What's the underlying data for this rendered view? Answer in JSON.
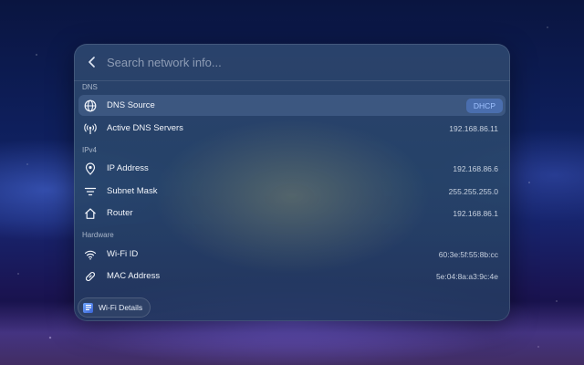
{
  "search": {
    "placeholder": "Search network info..."
  },
  "sections": {
    "dns": "DNS",
    "ipv4": "IPv4",
    "hardware": "Hardware"
  },
  "rows": {
    "dns_source": {
      "label": "DNS Source",
      "badge": "DHCP",
      "icon": "globe-icon"
    },
    "active_dns": {
      "label": "Active DNS Servers",
      "value": "192.168.86.11",
      "icon": "broadcast-icon"
    },
    "ip_address": {
      "label": "IP Address",
      "value": "192.168.86.6",
      "icon": "location-pin-icon"
    },
    "subnet_mask": {
      "label": "Subnet Mask",
      "value": "255.255.255.0",
      "icon": "filter-lines-icon"
    },
    "router": {
      "label": "Router",
      "value": "192.168.86.1",
      "icon": "home-icon"
    },
    "wifi_id": {
      "label": "Wi-Fi ID",
      "value": "60:3e:5f:55:8b:cc",
      "icon": "wifi-icon"
    },
    "mac_address": {
      "label": "MAC Address",
      "value": "5e:04:8a:a3:9c:4e",
      "icon": "link-icon"
    }
  },
  "footer": {
    "label": "Wi-Fi Details",
    "icon": "wifi-details-icon"
  },
  "colors": {
    "badge_bg": "#5a8ce6",
    "badge_text": "#9fc2ff"
  }
}
